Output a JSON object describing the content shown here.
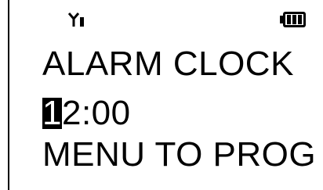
{
  "status": {
    "signal_icon": "signal-antenna-icon",
    "battery_icon": "battery-full-icon"
  },
  "display": {
    "title": "ALARM CLOCK",
    "time_cursor_digit": "1",
    "time_rest": "2:00",
    "hint": "MENU TO PROG"
  },
  "colors": {
    "background": "#ffffff",
    "foreground": "#000000"
  }
}
